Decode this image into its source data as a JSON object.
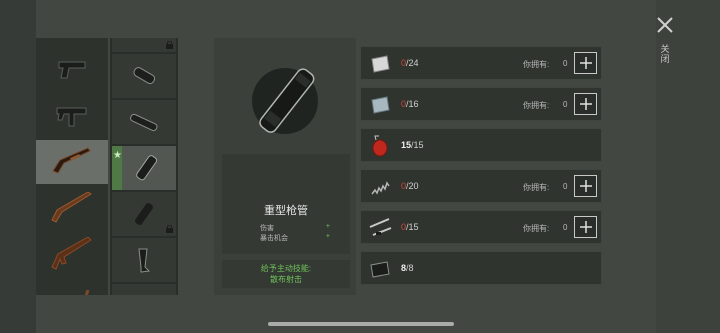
{
  "detail": {
    "item_name": "重型枪管",
    "stats": [
      {
        "label": "伤害",
        "sign": "+"
      },
      {
        "label": "暴击机会",
        "sign": "+"
      }
    ],
    "skill_line1": "给予主动技能:",
    "skill_line2": "散布射击"
  },
  "materials": [
    {
      "icon": "metal-plate-icon",
      "have": "0",
      "need": "/24",
      "own_label": "你拥有:",
      "own_value": "0",
      "addable": true
    },
    {
      "icon": "glass-plate-icon",
      "have": "0",
      "need": "/16",
      "own_label": "你拥有:",
      "own_value": "0",
      "addable": true
    },
    {
      "icon": "fuel-can-icon",
      "have": "15",
      "need": "/15",
      "own_label": "",
      "own_value": "",
      "addable": false
    },
    {
      "icon": "spring-icon",
      "have": "0",
      "need": "/20",
      "own_label": "你拥有:",
      "own_value": "0",
      "addable": true
    },
    {
      "icon": "pipe-parts-icon",
      "have": "0",
      "need": "/15",
      "own_label": "你拥有:",
      "own_value": "0",
      "addable": true
    },
    {
      "icon": "rubber-sheet-icon",
      "have": "8",
      "need": "/8",
      "own_label": "",
      "own_value": "",
      "addable": false
    }
  ],
  "close": {
    "label_1": "关",
    "label_2": "闭"
  },
  "colors": {
    "insufficient": "#d04a3a",
    "bonus": "#6fc05a",
    "selected_marker": "#4f7a45"
  }
}
